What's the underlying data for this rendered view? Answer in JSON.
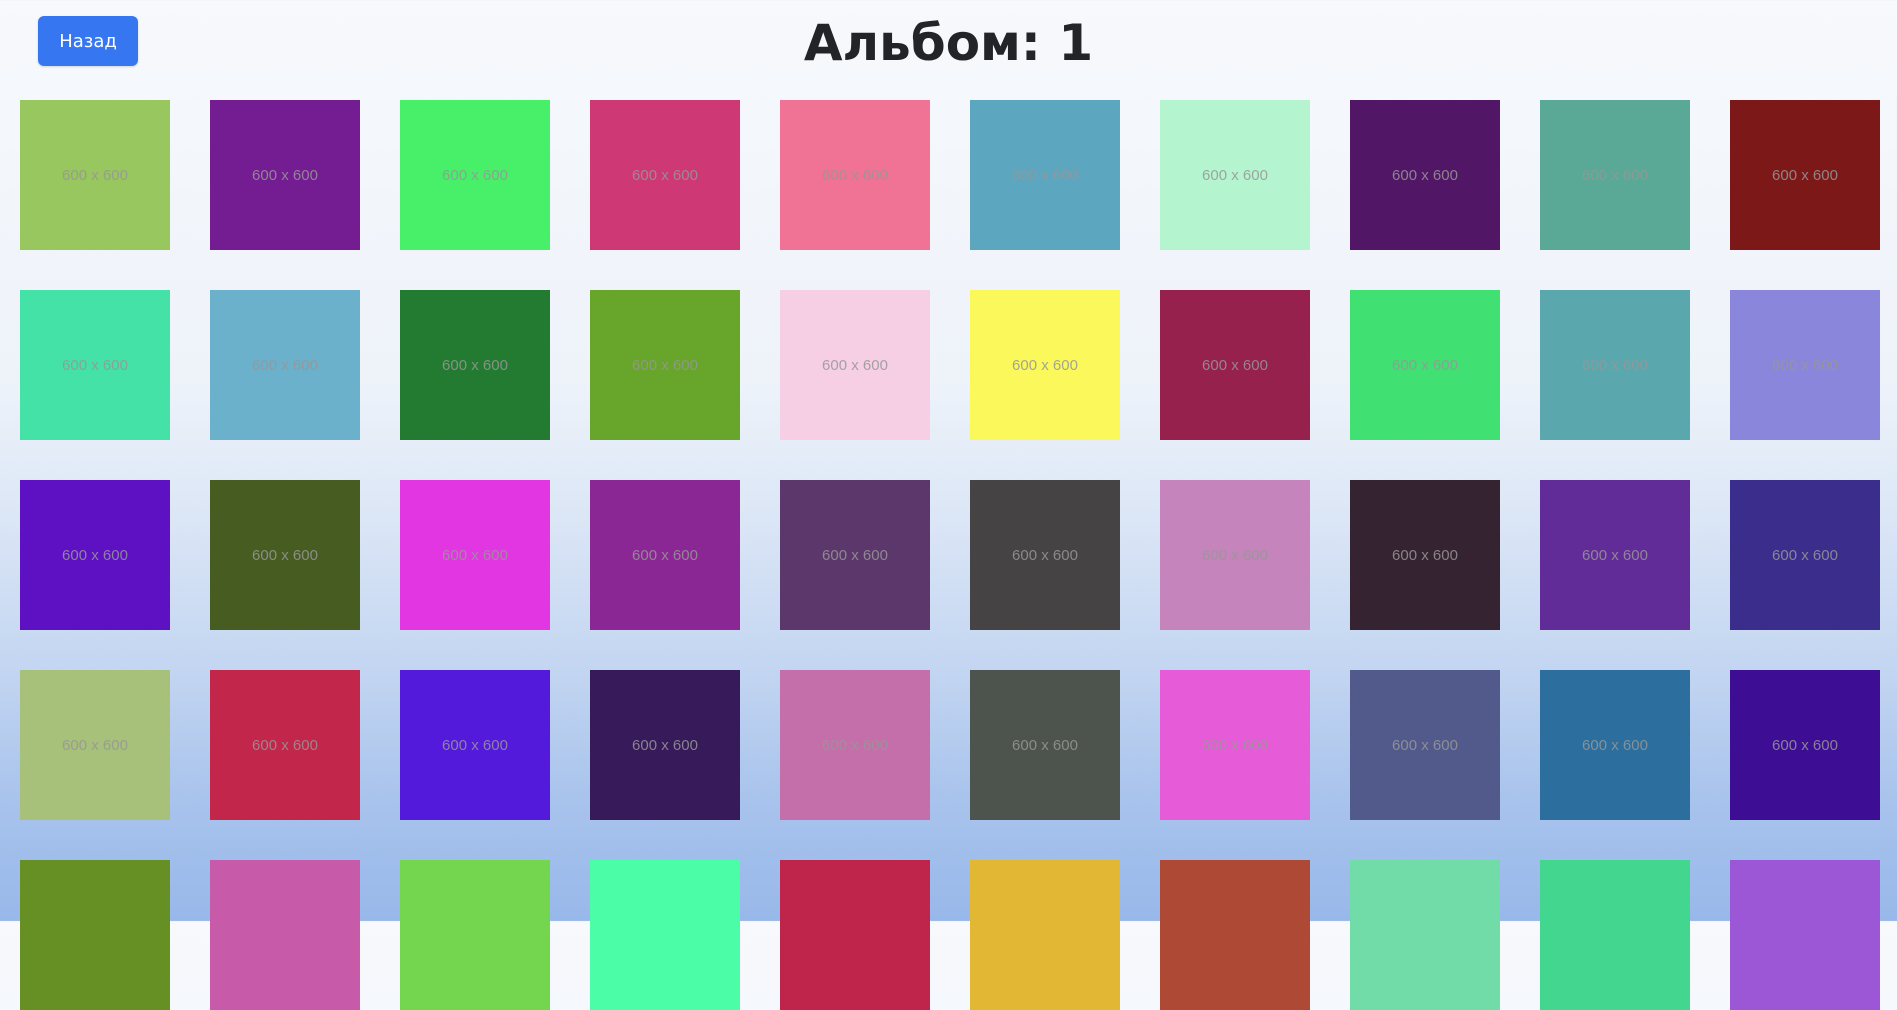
{
  "header": {
    "back_label": "Назад",
    "title": "Альбом: 1"
  },
  "tiles": [
    {
      "color": "#97c75e",
      "label": "600 x 600"
    },
    {
      "color": "#741c91",
      "label": "600 x 600"
    },
    {
      "color": "#48f06a",
      "label": "600 x 600"
    },
    {
      "color": "#cd3875",
      "label": "600 x 600"
    },
    {
      "color": "#f07294",
      "label": "600 x 600"
    },
    {
      "color": "#5da6bf",
      "label": "600 x 600"
    },
    {
      "color": "#b4f5d0",
      "label": "600 x 600"
    },
    {
      "color": "#521667",
      "label": "600 x 600"
    },
    {
      "color": "#5aa996",
      "label": "600 x 600"
    },
    {
      "color": "#7c1918",
      "label": "600 x 600"
    },
    {
      "color": "#45e2a7",
      "label": "600 x 600"
    },
    {
      "color": "#6bb1cb",
      "label": "600 x 600"
    },
    {
      "color": "#237b32",
      "label": "600 x 600"
    },
    {
      "color": "#67a52b",
      "label": "600 x 600"
    },
    {
      "color": "#f6cfe5",
      "label": "600 x 600"
    },
    {
      "color": "#fbf85b",
      "label": "600 x 600"
    },
    {
      "color": "#95214c",
      "label": "600 x 600"
    },
    {
      "color": "#40e073",
      "label": "600 x 600"
    },
    {
      "color": "#5aa8ae",
      "label": "600 x 600"
    },
    {
      "color": "#8986db",
      "label": "600 x 600"
    },
    {
      "color": "#5e10c3",
      "label": "600 x 600"
    },
    {
      "color": "#465c21",
      "label": "600 x 600"
    },
    {
      "color": "#e236e2",
      "label": "600 x 600"
    },
    {
      "color": "#8a2794",
      "label": "600 x 600"
    },
    {
      "color": "#5c376c",
      "label": "600 x 600"
    },
    {
      "color": "#454343",
      "label": "600 x 600"
    },
    {
      "color": "#c584bb",
      "label": "600 x 600"
    },
    {
      "color": "#352331",
      "label": "600 x 600"
    },
    {
      "color": "#612c98",
      "label": "600 x 600"
    },
    {
      "color": "#3a2d8c",
      "label": "600 x 600"
    },
    {
      "color": "#a7c07a",
      "label": "600 x 600"
    },
    {
      "color": "#c2264a",
      "label": "600 x 600"
    },
    {
      "color": "#531adb",
      "label": "600 x 600"
    },
    {
      "color": "#361a59",
      "label": "600 x 600"
    },
    {
      "color": "#c46faa",
      "label": "600 x 600"
    },
    {
      "color": "#4c544d",
      "label": "600 x 600"
    },
    {
      "color": "#e65cd8",
      "label": "600 x 600"
    },
    {
      "color": "#525a8b",
      "label": "600 x 600"
    },
    {
      "color": "#2c6e9e",
      "label": "600 x 600"
    },
    {
      "color": "#3d0e93",
      "label": "600 x 600"
    },
    {
      "color": "#669024",
      "label": ""
    },
    {
      "color": "#c75aa9",
      "label": ""
    },
    {
      "color": "#74d54e",
      "label": ""
    },
    {
      "color": "#4cfda8",
      "label": ""
    },
    {
      "color": "#bf254a",
      "label": ""
    },
    {
      "color": "#e2b734",
      "label": ""
    },
    {
      "color": "#ad4934",
      "label": ""
    },
    {
      "color": "#72dca9",
      "label": ""
    },
    {
      "color": "#43d68e",
      "label": ""
    },
    {
      "color": "#9c57d6",
      "label": ""
    }
  ]
}
